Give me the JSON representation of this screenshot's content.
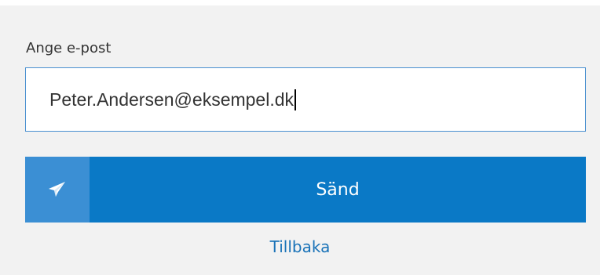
{
  "form": {
    "email_label": "Ange e-post",
    "email_value": "Peter.Andersen@eksempel.dk",
    "send_label": "Sänd",
    "send_icon": "paper-plane-icon",
    "back_label": "Tillbaka"
  },
  "colors": {
    "panel_background": "#f2f2f2",
    "field_border": "#4a90d0",
    "button_primary": "#0a79c6",
    "button_icon_background": "#3b8fd4",
    "link": "#1a73b8"
  }
}
